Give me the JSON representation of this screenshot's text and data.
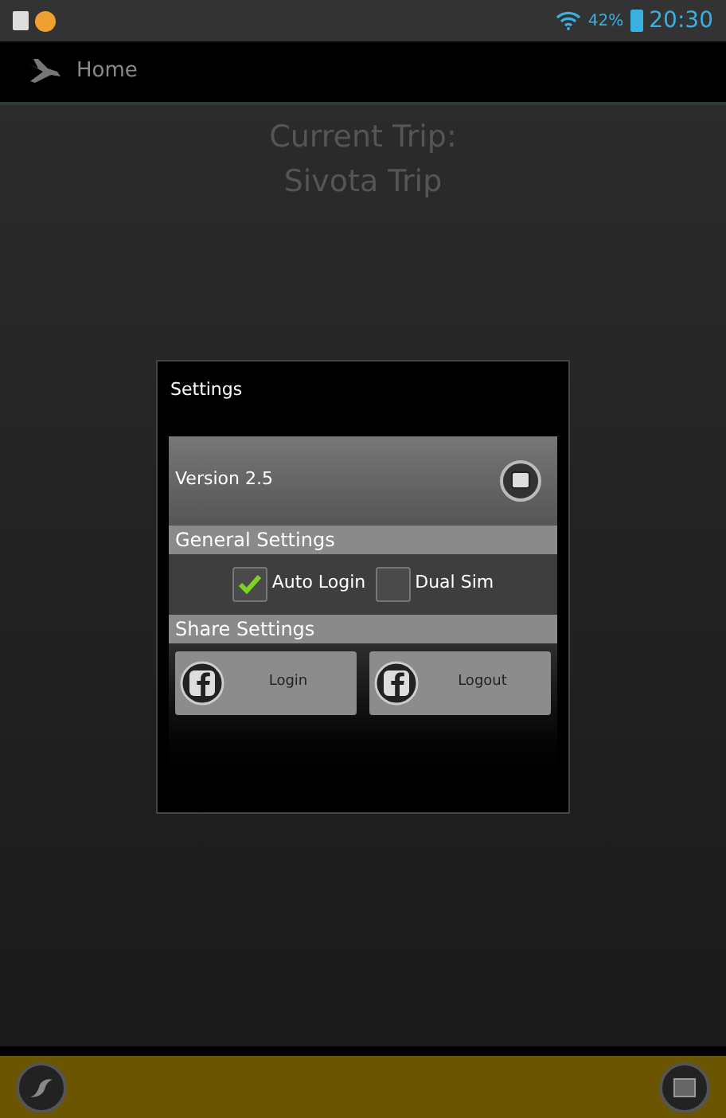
{
  "status_bar": {
    "battery": "42%",
    "time": "20:30"
  },
  "action_bar": {
    "title": "Home"
  },
  "trip": {
    "label": "Current Trip:",
    "name": "Sivota Trip"
  },
  "dialog": {
    "title": "Settings",
    "version": "Version 2.5",
    "general_header": "General Settings",
    "options": [
      {
        "label": "Auto Login",
        "checked": true
      },
      {
        "label": "Dual Sim",
        "checked": false
      }
    ],
    "share_header": "Share Settings",
    "buttons": [
      "Login",
      "Logout"
    ]
  }
}
